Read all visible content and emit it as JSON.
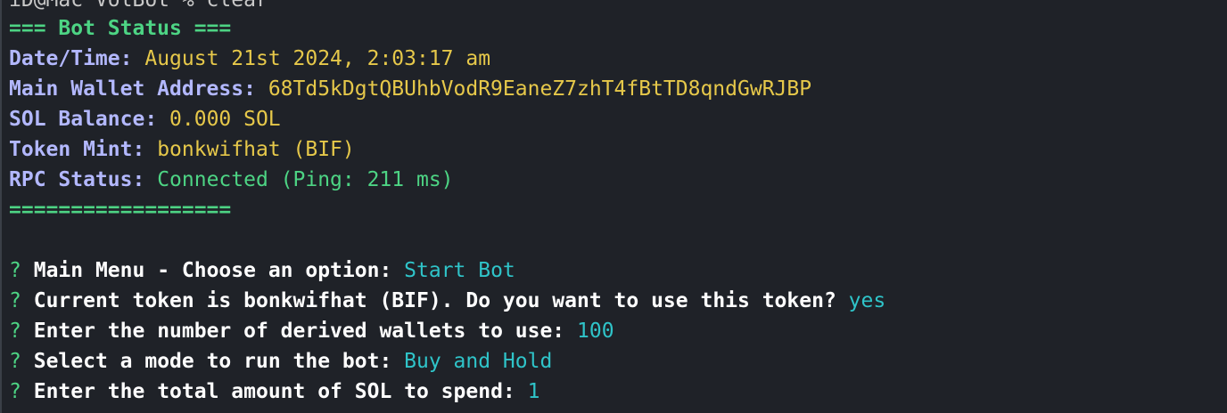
{
  "top_partial": "iD@Mac VolBot % clear",
  "status": {
    "header": "=== Bot Status ===",
    "datetime": {
      "label": "Date/Time:",
      "value": "August 21st 2024, 2:03:17 am"
    },
    "wallet": {
      "label": "Main Wallet Address:",
      "value": "68Td5kDgtQBUhbVodR9EaneZ7zhT4fBtTD8qndGwRJBP"
    },
    "balance": {
      "label": "SOL Balance:",
      "value": "0.000 SOL"
    },
    "token": {
      "label": "Token Mint:",
      "value": "bonkwifhat (BIF)"
    },
    "rpc": {
      "label": "RPC Status:",
      "value": "Connected (Ping: 211 ms)"
    },
    "footer": "=================="
  },
  "prompts": [
    {
      "marker": "?",
      "question": "Main Menu - Choose an option:",
      "answer": "Start Bot"
    },
    {
      "marker": "?",
      "question": "Current token is bonkwifhat (BIF). Do you want to use this token?",
      "answer": "yes"
    },
    {
      "marker": "?",
      "question": "Enter the number of derived wallets to use:",
      "answer": "100"
    },
    {
      "marker": "?",
      "question": "Select a mode to run the bot:",
      "answer": "Buy and Hold"
    },
    {
      "marker": "?",
      "question": "Enter the total amount of SOL to spend:",
      "answer": "1"
    }
  ],
  "colors": {
    "background": "#1f2228",
    "header_green": "#4dd484",
    "label_lavender": "#b3b8ff",
    "value_yellow": "#e6c84a",
    "answer_cyan": "#2fc4c9"
  }
}
